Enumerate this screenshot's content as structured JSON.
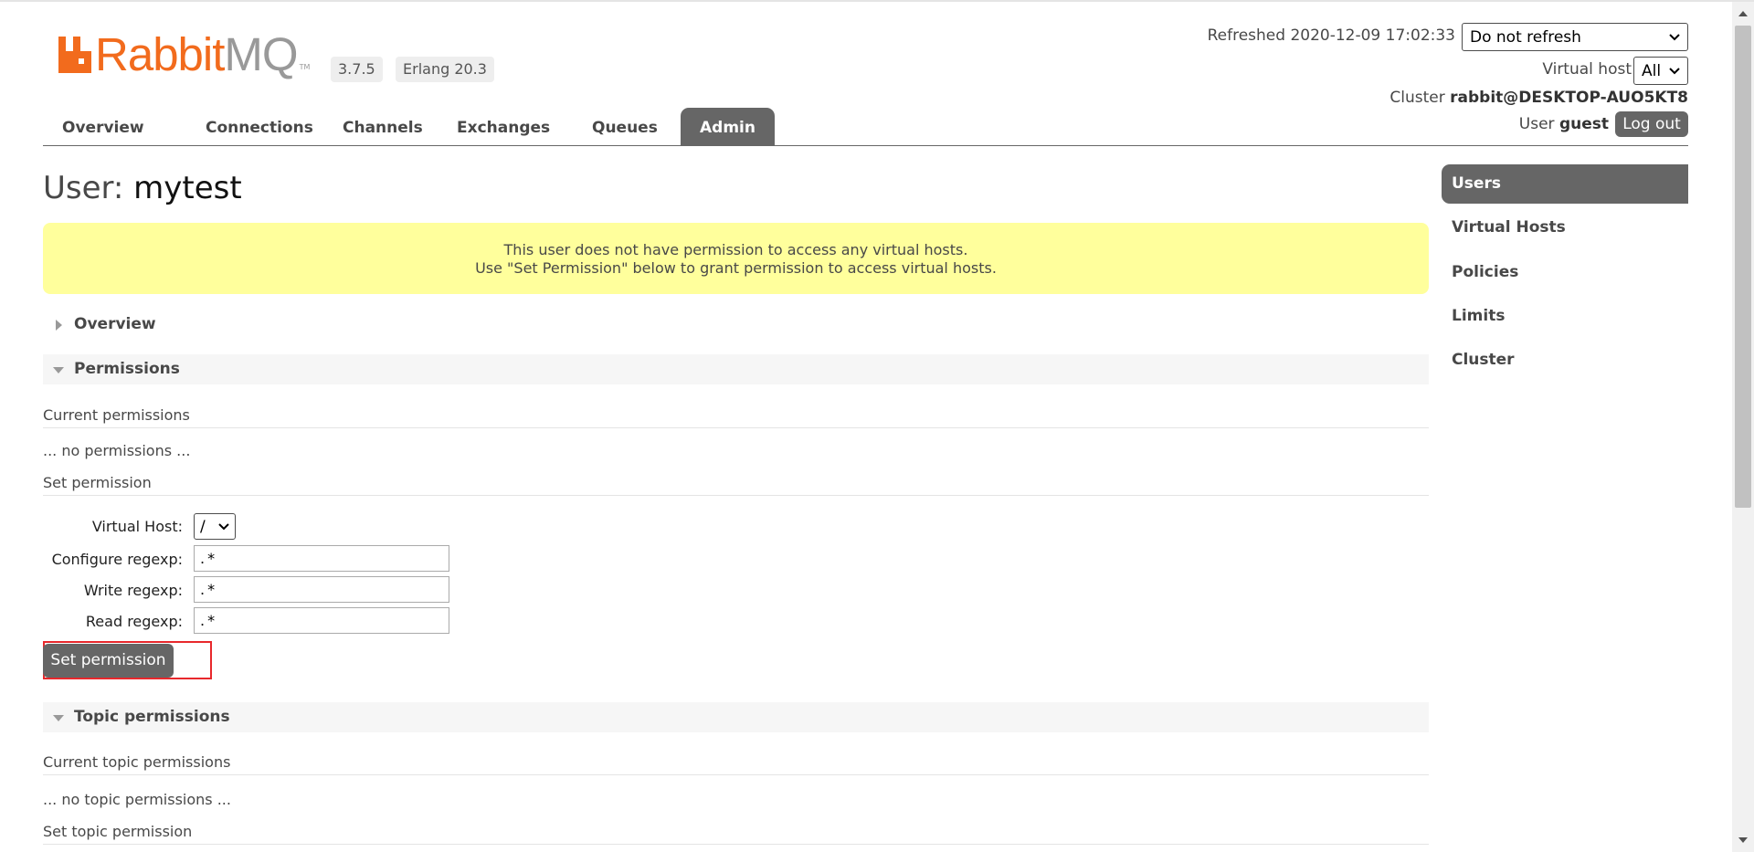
{
  "header": {
    "logo": "RabbitMQ",
    "logo_parts": {
      "rabbit": "Rabbit",
      "mq": "MQ",
      "tm": "TM"
    },
    "version": "3.7.5",
    "erlang": "Erlang 20.3",
    "refreshed_label": "Refreshed 2020-12-09 17:02:33",
    "refresh_option": "Do not refresh",
    "vhost_label": "Virtual host",
    "vhost_option": "All",
    "cluster_label": "Cluster",
    "cluster_value": "rabbit@DESKTOP-AUO5KT8",
    "user_label": "User",
    "user_value": "guest",
    "logout_label": "Log out"
  },
  "nav": {
    "tabs": [
      {
        "label": "Overview"
      },
      {
        "label": "Connections"
      },
      {
        "label": "Channels"
      },
      {
        "label": "Exchanges"
      },
      {
        "label": "Queues"
      },
      {
        "label": "Admin",
        "active": true
      }
    ]
  },
  "main": {
    "title_prefix": "User:",
    "title_name": "mytest",
    "warning_line1": "This user does not have permission to access any virtual hosts.",
    "warning_line2": "Use \"Set Permission\" below to grant permission to access virtual hosts.",
    "sections": {
      "overview": "Overview",
      "permissions": "Permissions",
      "topic_permissions": "Topic permissions"
    },
    "current_permissions": "Current permissions",
    "no_permissions": "... no permissions ...",
    "set_permission_heading": "Set permission",
    "form": {
      "vhost_label": "Virtual Host:",
      "vhost_value": "/",
      "configure_label": "Configure regexp:",
      "configure_value": ".*",
      "write_label": "Write regexp:",
      "write_value": ".*",
      "read_label": "Read regexp:",
      "read_value": ".*",
      "submit_label": "Set permission"
    },
    "current_topic_permissions": "Current topic permissions",
    "no_topic_permissions": "... no topic permissions ...",
    "set_topic_permission_heading": "Set topic permission"
  },
  "sidebar": {
    "items": [
      {
        "label": "Users",
        "active": true
      },
      {
        "label": "Virtual Hosts"
      },
      {
        "label": "Policies"
      },
      {
        "label": "Limits"
      },
      {
        "label": "Cluster"
      }
    ]
  },
  "colors": {
    "accent_orange": "#f26b1d",
    "tab_active": "#666666",
    "warning_bg": "#ffff9c",
    "highlight_red": "#e8282c"
  }
}
